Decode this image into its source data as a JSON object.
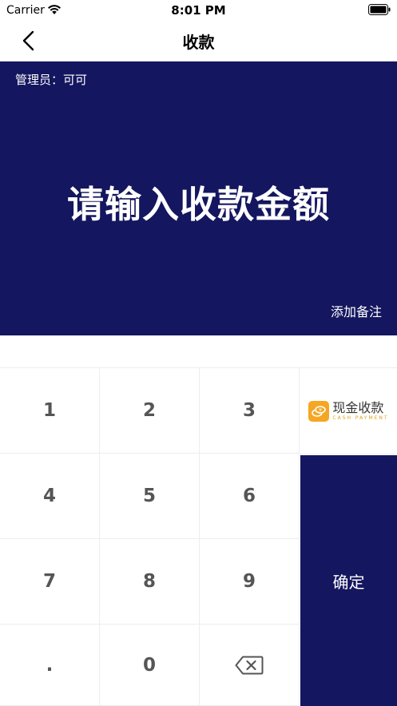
{
  "status_bar": {
    "carrier": "Carrier",
    "time": "8:01 PM"
  },
  "nav": {
    "title": "收款",
    "back_icon": "chevron-left-icon"
  },
  "hero": {
    "admin_label": "管理员：可可",
    "prompt": "请输入收款金额",
    "add_remark": "添加备注"
  },
  "keypad": {
    "keys": [
      "1",
      "2",
      "3",
      "4",
      "5",
      "6",
      "7",
      "8",
      "9",
      ".",
      "0"
    ],
    "delete_icon": "backspace-icon"
  },
  "cash_payment": {
    "label": "现金收款",
    "sub_label": "CASH PAYMENT",
    "icon": "cash-icon",
    "icon_color": "#f5a623"
  },
  "confirm": {
    "label": "确定"
  },
  "colors": {
    "primary": "#14165f",
    "key_text": "#555555"
  }
}
